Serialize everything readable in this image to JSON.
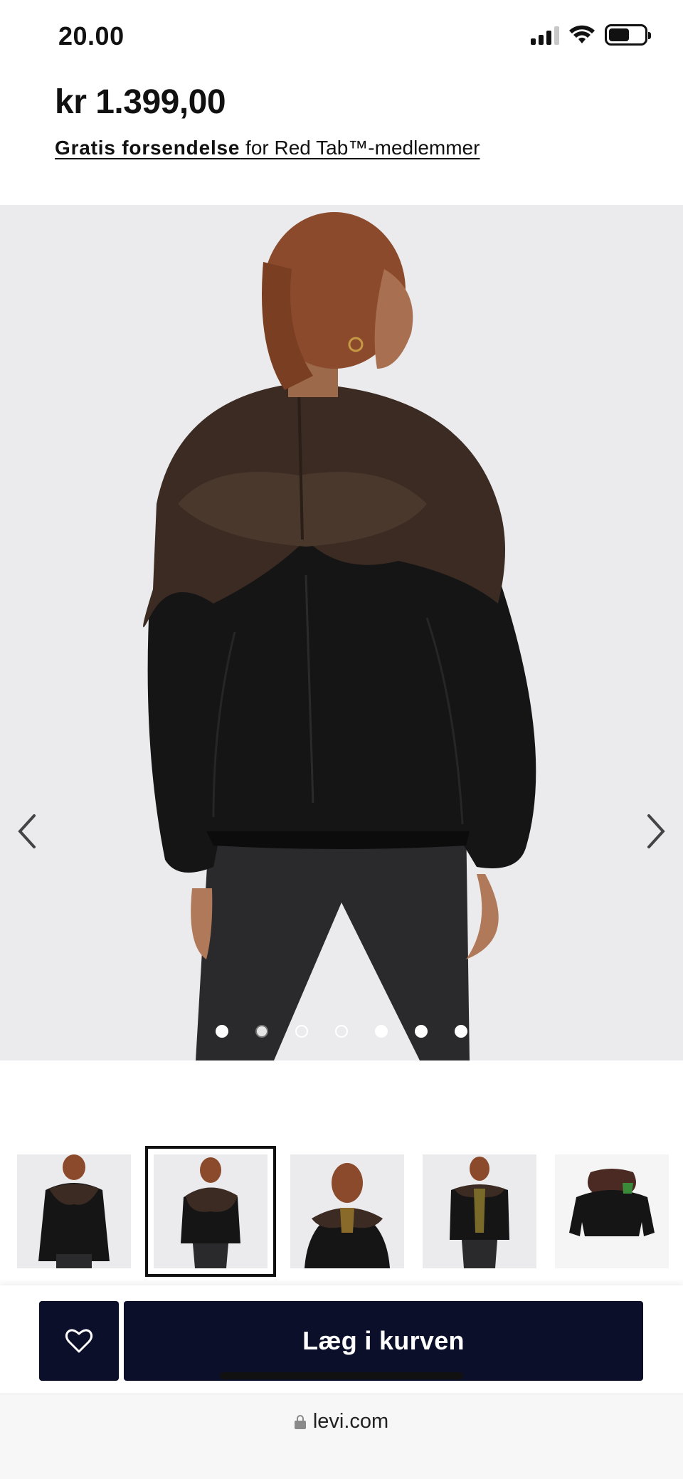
{
  "status_bar": {
    "time": "20.00",
    "icons": [
      "signal-icon",
      "wifi-icon",
      "battery-icon"
    ]
  },
  "product": {
    "price": "kr 1.399,00",
    "shipping_bold": "Gratis forsendelse",
    "shipping_rest": " for Red Tab™-medlemmer"
  },
  "gallery": {
    "prev_icon": "chevron-left-icon",
    "next_icon": "chevron-right-icon",
    "dot_count": 7,
    "active_dot": 1
  },
  "thumbnails": {
    "count": 5,
    "selected_index": 1
  },
  "actions": {
    "wishlist_icon": "heart-icon",
    "add_to_cart_label": "Læg i kurven"
  },
  "browser": {
    "url": "levi.com",
    "lock_icon": "lock-icon"
  },
  "colors": {
    "button_bg": "#0b0f2a",
    "image_bg": "#ebebed"
  }
}
